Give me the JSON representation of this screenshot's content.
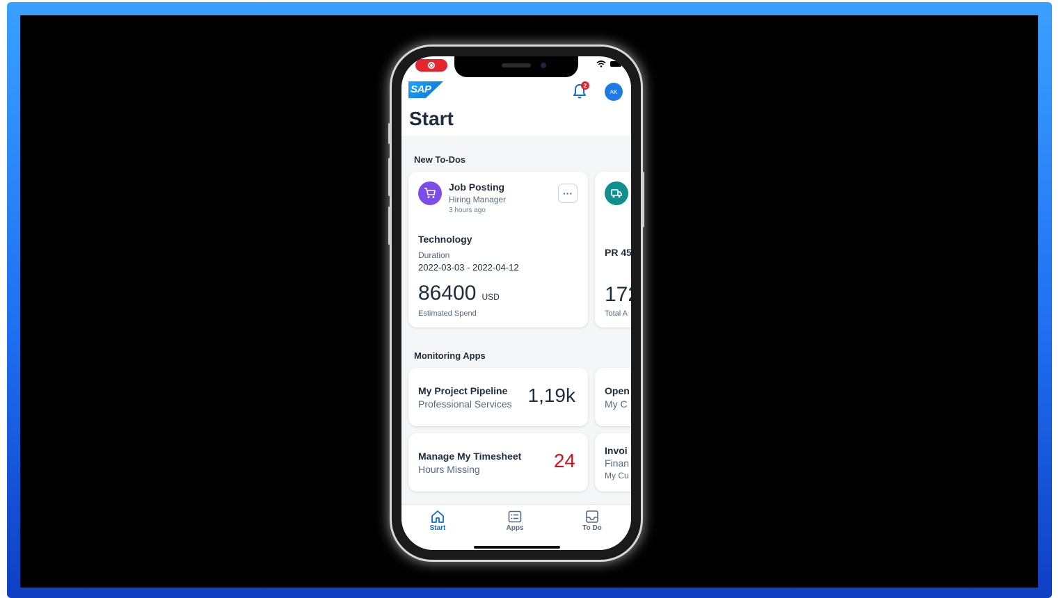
{
  "app": {
    "logo_text": "SAP",
    "notification_count": "2",
    "avatar_initials": "AK",
    "page_title": "Start"
  },
  "todos": {
    "section_title": "New To-Dos",
    "cards": [
      {
        "icon": "shopping-cart-icon",
        "title": "Job Posting",
        "subtitle": "Hiring Manager",
        "time": "3 hours ago",
        "category": "Technology",
        "field_label": "Duration",
        "field_value": "2022-03-03 - 2022-04-12",
        "amount": "86400",
        "unit": "USD",
        "amount_label": "Estimated Spend",
        "more_label": "···"
      },
      {
        "icon": "truck-icon",
        "title_partial": "PR 45",
        "amount_partial": "172",
        "amount_label_partial": "Total A"
      }
    ]
  },
  "monitoring": {
    "section_title": "Monitoring Apps",
    "tiles": [
      {
        "title": "My Project Pipeline",
        "subtitle": "Professional Services",
        "value": "1,19k",
        "value_color": "#1d2d3e"
      },
      {
        "title": "Manage My Timesheet",
        "subtitle": "Hours Missing",
        "value": "24",
        "value_color": "#d0161c"
      }
    ],
    "partial_tiles": [
      {
        "title": "Open",
        "subtitle": "My C"
      },
      {
        "title": "Invoi",
        "subtitle": "Finan",
        "extra": "My Cu"
      }
    ]
  },
  "tabs": [
    {
      "label": "Start",
      "icon": "home-icon",
      "active": true
    },
    {
      "label": "Apps",
      "icon": "apps-list-icon",
      "active": false
    },
    {
      "label": "To Do",
      "icon": "inbox-icon",
      "active": false
    }
  ],
  "colors": {
    "accent": "#0a6ed1",
    "frame_gradient_top": "#3aa0ff",
    "frame_gradient_bottom": "#0f3fc4",
    "critical": "#d0161c",
    "todo_icon_purple": "#7c4dea",
    "todo_icon_teal": "#0f8f8f"
  }
}
